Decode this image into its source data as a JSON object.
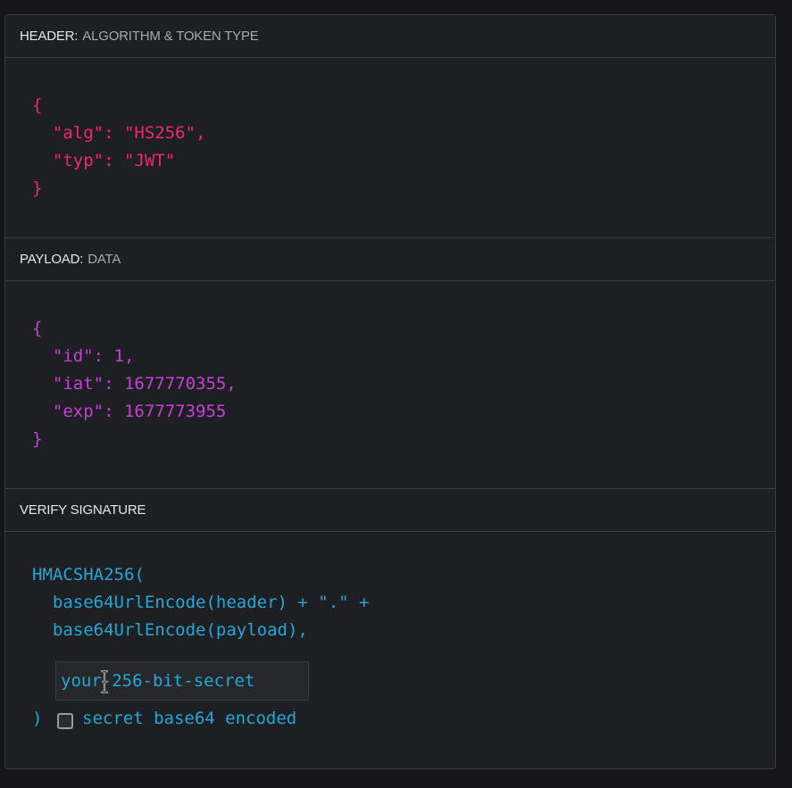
{
  "header": {
    "title": "HEADER:",
    "subtitle": "ALGORITHM & TOKEN TYPE",
    "code": "{\n  \"alg\": \"HS256\",\n  \"typ\": \"JWT\"\n}"
  },
  "payload": {
    "title": "PAYLOAD:",
    "subtitle": "DATA",
    "code": "{\n  \"id\": 1,\n  \"iat\": 1677770355,\n  \"exp\": 1677773955\n}"
  },
  "signature": {
    "title": "VERIFY SIGNATURE",
    "code": "HMACSHA256(\n  base64UrlEncode(header) + \".\" +\n  base64UrlEncode(payload),",
    "secret_value": "your-256-bit-secret",
    "close_paren": ")",
    "checkbox_label": "secret base64 encoded"
  },
  "icons": {
    "cursor": "text-cursor-icon",
    "checkbox": "checkbox-unchecked-icon"
  },
  "colors": {
    "header_code": "#f0266f",
    "payload_code": "#c63fd8",
    "signature_code": "#20a7d8",
    "background": "#1e1f22"
  }
}
